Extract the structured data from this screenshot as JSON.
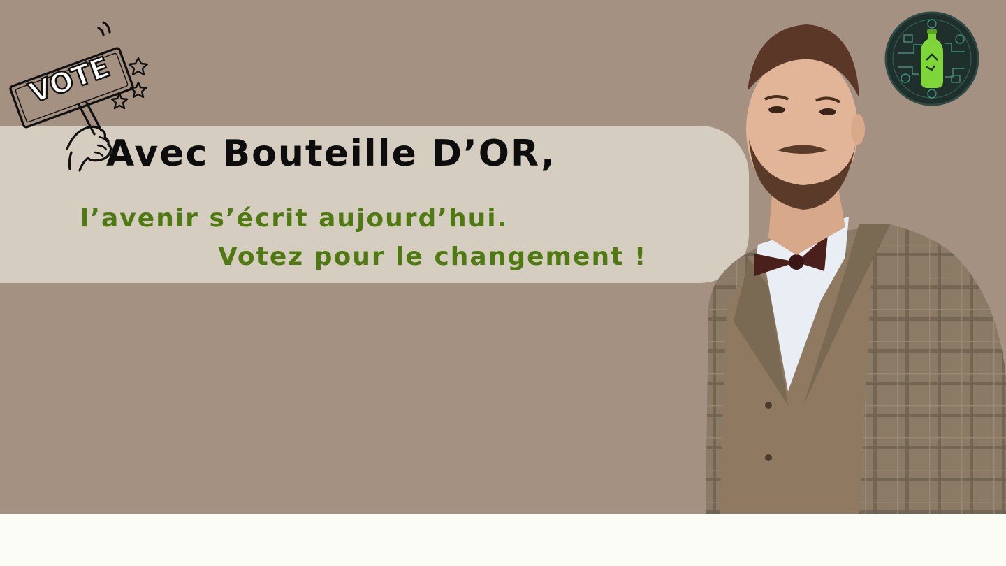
{
  "headline": "Avec Bouteille D’OR,",
  "tagline_line1": "l’avenir s’écrit aujourd’hui.",
  "tagline_line2": "Votez pour le changement !",
  "vote_sign_text": "VOTE",
  "colors": {
    "background": "#a59181",
    "pill": "#d5cdc0",
    "headline": "#0d0d0d",
    "tagline": "#4f7a12",
    "footer": "#fbfcf5",
    "badge_accent": "#7ed63a"
  },
  "icons": [
    "vote-sign-icon",
    "star-icon",
    "recycle-bottle-logo"
  ]
}
